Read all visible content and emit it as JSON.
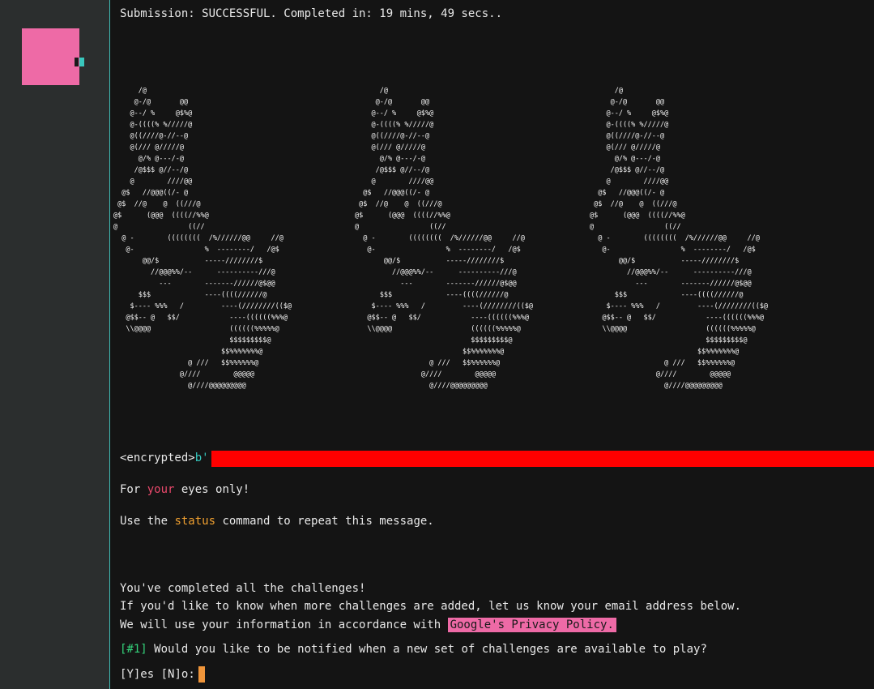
{
  "status_line": "Submission: SUCCESSFUL. Completed in: 19 mins, 49 secs..",
  "ascii_art": "      /@\n     @-/@       @@\n    @--/ %     @$%@\n    @-((((% %/////@\n    @((////@-//--@\n    @(/// @/////@\n      @/% @---/-@\n     /@$$$ @//--/@\n    @        ////@@\n  @$   //@@@((/- @\n @$  //@    @  ((///@\n@$      (@@@  ((((//%%@\n@                 ((//\n  @ -        ((((((((  /%//////@@     //@\n   @-                 %  --------/   /@$\n       @@/$           -----////////$\n         //@@@%%/--      ----------///@\n           ---        -------//////@$@@\n      $$$             ----((((//////@\n    $---- %%%   /         ----(////////(($@\n   @$$-- @   $$/            ----((((((%%%@\n   \\\\@@@@                   ((((((%%%%%@\n                            $$$$$$$$$@\n                          $$%%%%%%%@\n                  @ ///   $$%%%%%%@\n                @////        @@@@@\n                  @////@@@@@@@@@",
  "encrypted": {
    "label": "<encrypted>",
    "prefix": "b'"
  },
  "eyes_only": {
    "before": "For ",
    "highlight": "your",
    "after": " eyes only!"
  },
  "status_hint": {
    "before": "Use the ",
    "command": "status",
    "after": " command to repeat this message."
  },
  "completion": {
    "line1": "You've completed all the challenges!",
    "line2": "If you'd like to know when more challenges are added, let us know your email address below.",
    "line3_before": "We will use your information in accordance with ",
    "privacy_link": "Google's Privacy Policy."
  },
  "question": {
    "number": "[#1]",
    "text": " Would you like to be notified when a new set of challenges are available to play?"
  },
  "prompt": {
    "y_open": "[",
    "y_key": "Y",
    "y_rest": "]es ",
    "n_open": "[",
    "n_key": "N",
    "n_rest": "]o:"
  },
  "colors": {
    "accent_pink": "#ee6aa6",
    "redaction": "#ff0000",
    "highlight_red": "#e8486b",
    "command_orange": "#f0a030",
    "cursor_orange": "#f0953a",
    "teal": "#36c9c0"
  }
}
